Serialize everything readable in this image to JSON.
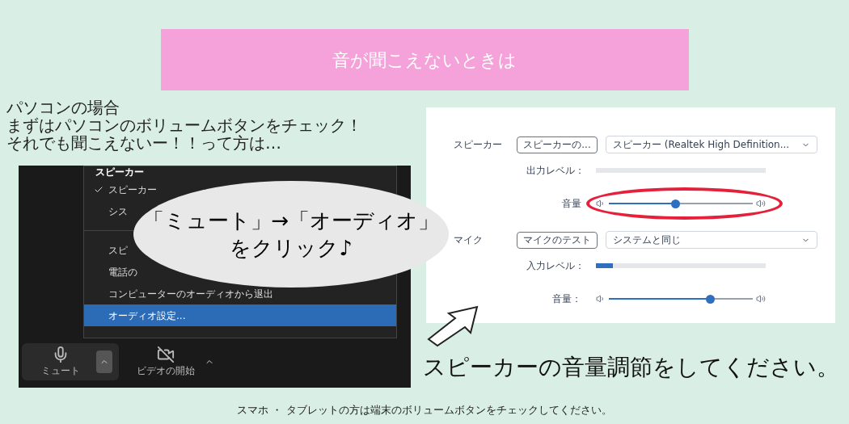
{
  "banner": {
    "title": "音が聞こえないときは"
  },
  "intro": {
    "lines": [
      "パソコンの場合",
      "まずはパソコンのボリュームボタンをチェック！",
      "それでも聞こえないー！！って方は…"
    ]
  },
  "zoom_menu": {
    "header": "スピーカー",
    "item_groups": [
      [
        {
          "label": "スピーカー",
          "checked": true,
          "selected": false
        },
        {
          "label": "シス",
          "checked": false,
          "selected": false
        }
      ],
      [
        {
          "label": "スピ",
          "checked": false,
          "selected": false
        },
        {
          "label": "電話の",
          "checked": false,
          "selected": false
        },
        {
          "label": "コンピューターのオーディオから退出",
          "checked": false,
          "selected": false
        },
        {
          "label": "オーディオ設定...",
          "checked": false,
          "selected": true
        }
      ]
    ],
    "toolbar": [
      {
        "label": "ミュート",
        "kind": "mic"
      },
      {
        "label": "ビデオの開始",
        "kind": "video"
      }
    ]
  },
  "callout": {
    "lines": [
      "「ミュート」→「オーディオ」",
      "をクリック♪"
    ]
  },
  "audio_settings": {
    "sections": [
      {
        "label": "スピーカー",
        "test_button": "スピーカーの...",
        "device": "スピーカー (Realtek High Definition...",
        "level_label": "出力レベル：",
        "meter": {
          "level": 0
        },
        "volume_label": "音量",
        "volume": {
          "level": 0.46
        },
        "highlighted": true
      },
      {
        "label": "マイク",
        "test_button": "マイクのテスト",
        "device": "システムと同じ",
        "level_label": "入力レベル：",
        "meter": {
          "level": 0.1
        },
        "volume_label": "音量：",
        "volume": {
          "level": 0.7
        },
        "highlighted": false
      }
    ]
  },
  "caption": "スピーカーの音量調節をしてください。",
  "footnote": "スマホ ・ タブレットの方は端末のボリュームボタンをチェックしてください。"
}
